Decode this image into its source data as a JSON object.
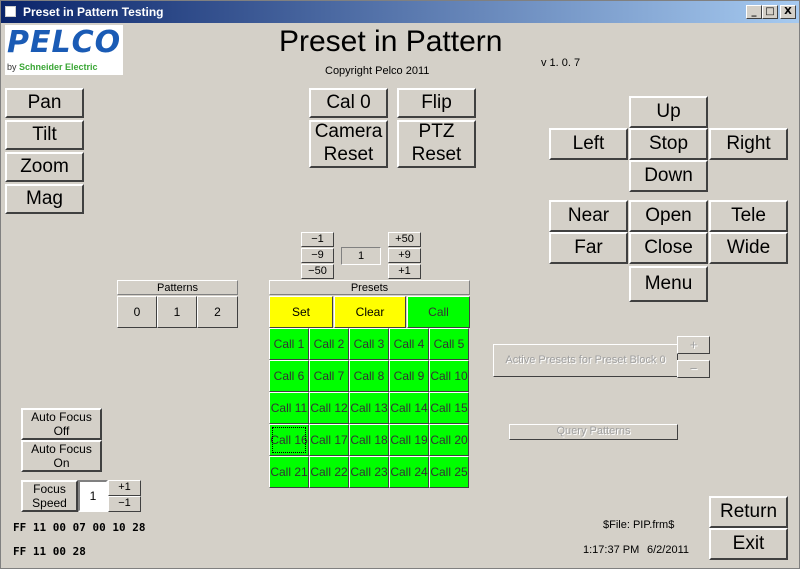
{
  "window": {
    "title": "Preset in Pattern Testing",
    "controls": [
      "_",
      "□",
      "X"
    ]
  },
  "logo": {
    "brand": "PELCO",
    "by": "by",
    "company": "Schneider Electric"
  },
  "header": {
    "title": "Preset in Pattern",
    "copyright": "Copyright Pelco 2011",
    "version": "v 1. 0. 7"
  },
  "left_buttons": {
    "pan": "Pan",
    "tilt": "Tilt",
    "zoom": "Zoom",
    "mag": "Mag"
  },
  "top_buttons": {
    "cal0": "Cal 0",
    "flip": "Flip",
    "camera_reset": "Camera\nReset",
    "ptz_reset": "PTZ\nReset"
  },
  "direction": {
    "up": "Up",
    "left": "Left",
    "stop": "Stop",
    "right": "Right",
    "down": "Down"
  },
  "lens": {
    "near": "Near",
    "open": "Open",
    "tele": "Tele",
    "far": "Far",
    "close": "Close",
    "wide": "Wide",
    "menu": "Menu"
  },
  "stepper": {
    "minus1": "−1",
    "minus9": "−9",
    "minus50": "−50",
    "value": "1",
    "plus50": "+50",
    "plus9": "+9",
    "plus1": "+1"
  },
  "patterns": {
    "header": "Patterns",
    "items": [
      "0",
      "1",
      "2"
    ]
  },
  "presets": {
    "header": "Presets",
    "set": "Set",
    "clear": "Clear",
    "call": "Call",
    "calls": [
      "Call 1",
      "Call 2",
      "Call 3",
      "Call 4",
      "Call 5",
      "Call 6",
      "Call 7",
      "Call 8",
      "Call 9",
      "Call 10",
      "Call 11",
      "Call 12",
      "Call 13",
      "Call 14",
      "Call 15",
      "Call 16",
      "Call 17",
      "Call 18",
      "Call 19",
      "Call 20",
      "Call 21",
      "Call 22",
      "Call 23",
      "Call 24",
      "Call 25"
    ]
  },
  "active_presets": {
    "label": "Active Presets for Preset Block 0",
    "plus": "+",
    "minus": "−"
  },
  "query_patterns": "Query Patterns",
  "focus": {
    "auto_off": "Auto Focus\nOff",
    "auto_on": "Auto Focus\nOn",
    "speed_label": "Focus\nSpeed",
    "speed_value": "1",
    "plus1": "+1",
    "minus1": "−1"
  },
  "hex": {
    "line1": "FF 11 00 07 00 10 28",
    "line2": "FF 11 00 28"
  },
  "footer": {
    "file": "$File: PIP.frm$",
    "time": "1:17:37 PM",
    "date": "6/2/2011"
  },
  "actions": {
    "return": "Return",
    "exit": "Exit"
  },
  "colors": {
    "green": "#00ff00",
    "yellow": "#ffff00",
    "title_bar": "#0a246a",
    "logo_blue": "#1a5bb5"
  }
}
